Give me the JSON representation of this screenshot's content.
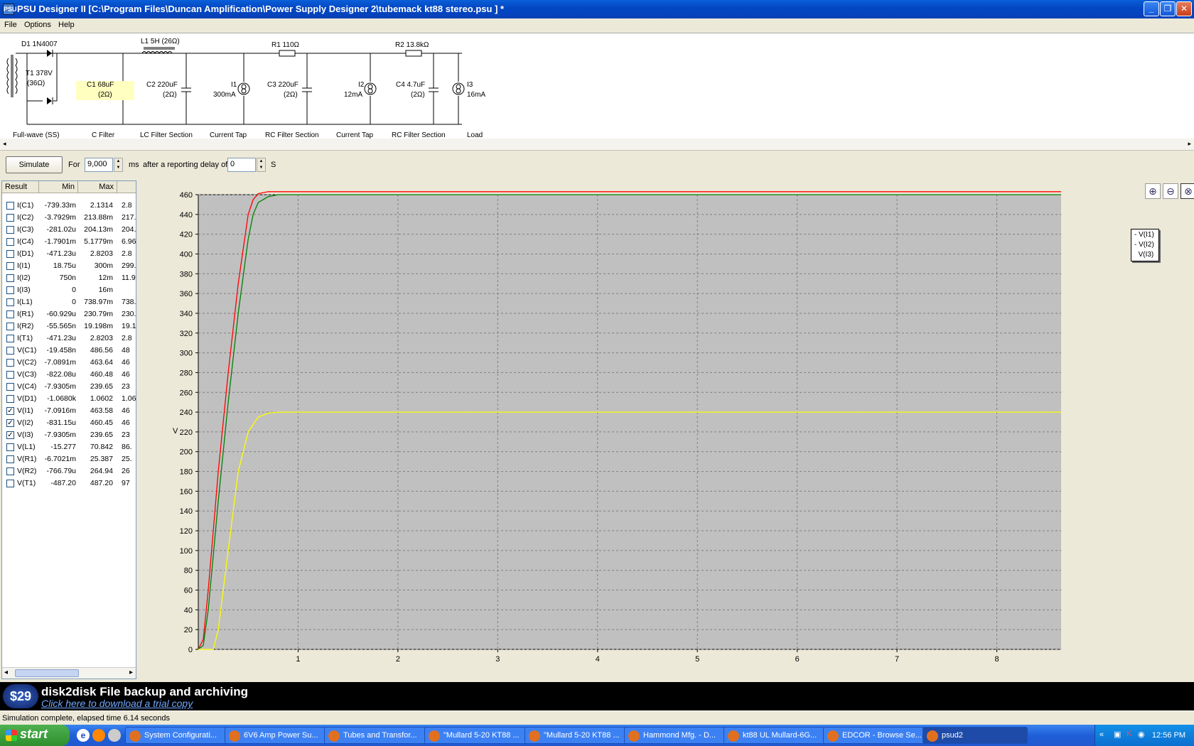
{
  "window": {
    "title": "PSU Designer II  [C:\\Program Files\\Duncan Amplification\\Power Supply Designer 2\\tubemack kt88 stereo.psu ] *",
    "icon_label": "PSU"
  },
  "menu": [
    "File",
    "Options",
    "Help"
  ],
  "schematic": {
    "labels": {
      "d1": "D1 1N4007",
      "l1": "L1 5H (26Ω)",
      "r1": "R1 110Ω",
      "r2": "R2 13.8kΩ",
      "t1": "T1 378V",
      "t1_res": "(36Ω)",
      "c1": "C1 68uF",
      "c1_res": "(2Ω)",
      "c2": "C2 220uF",
      "c2_res": "(2Ω)",
      "i1": "I1",
      "i1_val": "300mA",
      "c3": "C3 220uF",
      "c3_res": "(2Ω)",
      "i2": "I2",
      "i2_val": "12mA",
      "c4": "C4 4.7uF",
      "c4_res": "(2Ω)",
      "i3": "I3",
      "i3_val": "16mA"
    },
    "sections": [
      "Full-wave (SS)",
      "C Filter",
      "LC Filter Section",
      "Current Tap",
      "RC Filter Section",
      "Current Tap",
      "RC Filter Section",
      "Load"
    ]
  },
  "sim": {
    "button": "Simulate",
    "for_label": "For",
    "duration": "9,000",
    "ms_label": "ms",
    "delay_label": "after a reporting delay of",
    "delay": "0",
    "s_label": "S"
  },
  "results": {
    "headers": [
      "Result",
      "Min",
      "Max"
    ],
    "rows": [
      {
        "name": "I(C1)",
        "min": "-739.33m",
        "max": "2.1314",
        "extra": "2.8",
        "checked": false
      },
      {
        "name": "I(C2)",
        "min": "-3.7929m",
        "max": "213.88m",
        "extra": "217.",
        "checked": false
      },
      {
        "name": "I(C3)",
        "min": "-281.02u",
        "max": "204.13m",
        "extra": "204.",
        "checked": false
      },
      {
        "name": "I(C4)",
        "min": "-1.7901m",
        "max": "5.1779m",
        "extra": "6.96",
        "checked": false
      },
      {
        "name": "I(D1)",
        "min": "-471.23u",
        "max": "2.8203",
        "extra": "2.8",
        "checked": false
      },
      {
        "name": "I(I1)",
        "min": "18.75u",
        "max": "300m",
        "extra": "299.",
        "checked": false
      },
      {
        "name": "I(I2)",
        "min": "750n",
        "max": "12m",
        "extra": "11.9",
        "checked": false
      },
      {
        "name": "I(I3)",
        "min": "0",
        "max": "16m",
        "extra": "",
        "checked": false
      },
      {
        "name": "I(L1)",
        "min": "0",
        "max": "738.97m",
        "extra": "738.",
        "checked": false
      },
      {
        "name": "I(R1)",
        "min": "-60.929u",
        "max": "230.79m",
        "extra": "230.",
        "checked": false
      },
      {
        "name": "I(R2)",
        "min": "-55.565n",
        "max": "19.198m",
        "extra": "19.1",
        "checked": false
      },
      {
        "name": "I(T1)",
        "min": "-471.23u",
        "max": "2.8203",
        "extra": "2.8",
        "checked": false
      },
      {
        "name": "V(C1)",
        "min": "-19.458n",
        "max": "486.56",
        "extra": "48",
        "checked": false
      },
      {
        "name": "V(C2)",
        "min": "-7.0891m",
        "max": "463.64",
        "extra": "46",
        "checked": false
      },
      {
        "name": "V(C3)",
        "min": "-822.08u",
        "max": "460.48",
        "extra": "46",
        "checked": false
      },
      {
        "name": "V(C4)",
        "min": "-7.9305m",
        "max": "239.65",
        "extra": "23",
        "checked": false
      },
      {
        "name": "V(D1)",
        "min": "-1.0680k",
        "max": "1.0602",
        "extra": "1.06",
        "checked": false
      },
      {
        "name": "V(I1)",
        "min": "-7.0916m",
        "max": "463.58",
        "extra": "46",
        "checked": true
      },
      {
        "name": "V(I2)",
        "min": "-831.15u",
        "max": "460.45",
        "extra": "46",
        "checked": true
      },
      {
        "name": "V(I3)",
        "min": "-7.9305m",
        "max": "239.65",
        "extra": "23",
        "checked": true
      },
      {
        "name": "V(L1)",
        "min": "-15.277",
        "max": "70.842",
        "extra": "86.",
        "checked": false
      },
      {
        "name": "V(R1)",
        "min": "-6.7021m",
        "max": "25.387",
        "extra": "25.",
        "checked": false
      },
      {
        "name": "V(R2)",
        "min": "-766.79u",
        "max": "264.94",
        "extra": "26",
        "checked": false
      },
      {
        "name": "V(T1)",
        "min": "-487.20",
        "max": "487.20",
        "extra": "97",
        "checked": false
      }
    ]
  },
  "chart_data": {
    "type": "line",
    "title": "",
    "xlabel": "",
    "ylabel": "V",
    "xlim": [
      0,
      9
    ],
    "ylim": [
      0,
      460
    ],
    "x_ticks": [
      1,
      2,
      3,
      4,
      5,
      6,
      7,
      8
    ],
    "y_ticks": [
      0,
      20,
      40,
      60,
      80,
      100,
      120,
      140,
      160,
      180,
      200,
      220,
      240,
      260,
      280,
      300,
      320,
      340,
      360,
      380,
      400,
      420,
      440,
      460
    ],
    "grid": true,
    "legend_position": "right",
    "series": [
      {
        "name": "V(I1)",
        "color": "#ff0000",
        "x": [
          0,
          0.05,
          0.1,
          0.15,
          0.2,
          0.3,
          0.4,
          0.5,
          0.55,
          0.6,
          0.7,
          0.8,
          9
        ],
        "y": [
          0,
          10,
          60,
          120,
          180,
          280,
          370,
          440,
          455,
          461,
          463,
          463,
          463
        ]
      },
      {
        "name": "V(I2)",
        "color": "#008000",
        "x": [
          0,
          0.05,
          0.1,
          0.15,
          0.2,
          0.3,
          0.4,
          0.5,
          0.55,
          0.6,
          0.7,
          0.8,
          9
        ],
        "y": [
          0,
          4,
          40,
          95,
          150,
          250,
          340,
          415,
          440,
          452,
          458,
          460,
          460
        ]
      },
      {
        "name": "V(I3)",
        "color": "#ffff00",
        "x": [
          0,
          0.15,
          0.2,
          0.3,
          0.4,
          0.5,
          0.6,
          0.7,
          0.8,
          9
        ],
        "y": [
          0,
          0,
          20,
          100,
          180,
          220,
          235,
          239,
          240,
          240
        ]
      }
    ]
  },
  "zoom_buttons": [
    "zoom-in-icon",
    "zoom-out-icon",
    "zoom-reset-icon"
  ],
  "ad": {
    "price": "$29",
    "headline": "disk2disk File backup and archiving",
    "link": "Click here to download a trial copy"
  },
  "status": "Simulation complete, elapsed time 6.14 seconds",
  "taskbar": {
    "start": "start",
    "tasks": [
      "System Configurati...",
      "6V6 Amp Power Su...",
      "Tubes and Transfor...",
      "\"Mullard 5-20 KT88 ...",
      "\"Mullard 5-20 KT88 ...",
      "Hammond Mfg. - D...",
      "kt88 UL Mullard-6G...",
      "EDCOR - Browse Se...",
      "psud2"
    ],
    "clock": "12:56 PM"
  }
}
